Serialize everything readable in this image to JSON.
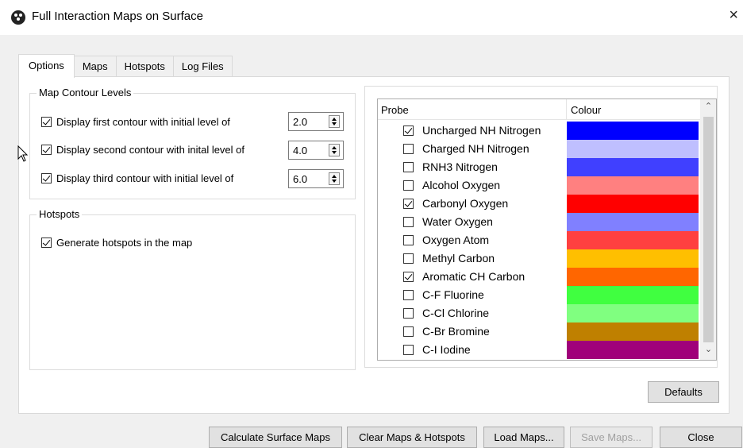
{
  "window": {
    "title": "Full Interaction Maps on Surface",
    "close_glyph": "×",
    "icon": "app-logo-icon"
  },
  "tabs": [
    {
      "label": "Options",
      "active": true
    },
    {
      "label": "Maps",
      "active": false
    },
    {
      "label": "Hotspots",
      "active": false
    },
    {
      "label": "Log Files",
      "active": false
    }
  ],
  "contours": {
    "group_title": "Map Contour Levels",
    "items": [
      {
        "label": "Display first contour with initial level of",
        "checked": true,
        "value": "2.0"
      },
      {
        "label": "Display second contour with inital level of",
        "checked": true,
        "value": "4.0"
      },
      {
        "label": "Display third contour with initial level of",
        "checked": true,
        "value": "6.0"
      }
    ]
  },
  "hotspots": {
    "group_title": "Hotspots",
    "label": "Generate hotspots in the map",
    "checked": true
  },
  "probe_table": {
    "col_probe": "Probe",
    "col_colour": "Colour",
    "rows": [
      {
        "name": "Uncharged NH Nitrogen",
        "checked": true,
        "color": "#0000ff"
      },
      {
        "name": "Charged NH Nitrogen",
        "checked": false,
        "color": "#bfbfff"
      },
      {
        "name": "RNH3 Nitrogen",
        "checked": false,
        "color": "#4040ff"
      },
      {
        "name": "Alcohol Oxygen",
        "checked": false,
        "color": "#ff8080"
      },
      {
        "name": "Carbonyl Oxygen",
        "checked": true,
        "color": "#ff0000"
      },
      {
        "name": "Water Oxygen",
        "checked": false,
        "color": "#8080ff"
      },
      {
        "name": "Oxygen Atom",
        "checked": false,
        "color": "#ff4040"
      },
      {
        "name": "Methyl Carbon",
        "checked": false,
        "color": "#ffbf00"
      },
      {
        "name": "Aromatic CH Carbon",
        "checked": true,
        "color": "#ff6600"
      },
      {
        "name": "C-F Fluorine",
        "checked": false,
        "color": "#40ff40"
      },
      {
        "name": "C-Cl Chlorine",
        "checked": false,
        "color": "#80ff80"
      },
      {
        "name": "C-Br Bromine",
        "checked": false,
        "color": "#bf8000"
      },
      {
        "name": "C-I Iodine",
        "checked": false,
        "color": "#a0007a"
      }
    ]
  },
  "buttons": {
    "defaults": "Defaults",
    "calculate": "Calculate Surface Maps",
    "clear": "Clear Maps & Hotspots",
    "load": "Load Maps...",
    "save": "Save Maps...",
    "close": "Close"
  }
}
